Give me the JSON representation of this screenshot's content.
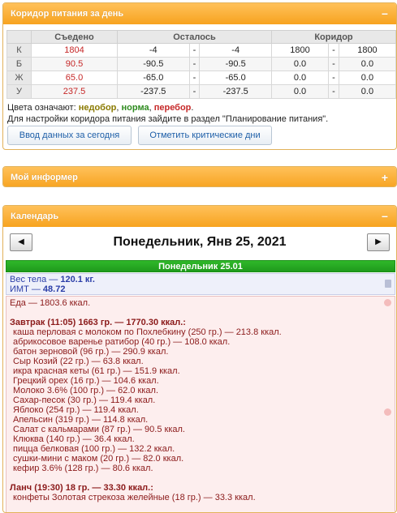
{
  "corridor": {
    "title": "Коридор питания за день",
    "toggle": "−",
    "headers": [
      "",
      "Съедено",
      "Осталось",
      "Коридор"
    ],
    "rows": [
      {
        "label": "К",
        "eaten": "1804",
        "r1": "-4",
        "dash1": "-",
        "r2": "-4",
        "c1": "1800",
        "dash2": "-",
        "c2": "1800"
      },
      {
        "label": "Б",
        "eaten": "90.5",
        "r1": "-90.5",
        "dash1": "-",
        "r2": "-90.5",
        "c1": "0.0",
        "dash2": "-",
        "c2": "0.0"
      },
      {
        "label": "Ж",
        "eaten": "65.0",
        "r1": "-65.0",
        "dash1": "-",
        "r2": "-65.0",
        "c1": "0.0",
        "dash2": "-",
        "c2": "0.0"
      },
      {
        "label": "У",
        "eaten": "237.5",
        "r1": "-237.5",
        "dash1": "-",
        "r2": "-237.5",
        "c1": "0.0",
        "dash2": "-",
        "c2": "0.0"
      }
    ],
    "legend_prefix": "Цвета означают: ",
    "legend_low": "недобор",
    "legend_sep1": ", ",
    "legend_ok": "норма",
    "legend_sep2": ", ",
    "legend_over": "перебор",
    "legend_end": ".",
    "hint": "Для настройки коридора питания зайдите в раздел \"Планирование питания\".",
    "btn_input": "Ввод данных за сегодня",
    "btn_critical": "Отметить критические дни",
    "colors": {
      "low": "#8a7a00",
      "ok": "#2e8b1f",
      "over": "#c62828"
    }
  },
  "informer": {
    "title": "Мой информер",
    "toggle": "+"
  },
  "calendar": {
    "title": "Календарь",
    "toggle": "−",
    "prev": "◀",
    "next": "▶",
    "date_title": "Понедельник, Янв 25, 2021",
    "day_bar": "Понедельник 25.01",
    "weight_line": "Вес тела — ",
    "weight_value": "120.1 кг.",
    "bmi_line": "ИМТ — ",
    "bmi_value": "48.72",
    "food_total": "Еда — 1803.6 ккал.",
    "meals": [
      {
        "title": "Завтрак (11:05) 1663 гр. — 1770.30 ккал.:",
        "items": [
          "каша перловая с молоком по Похлебкину (250 гр.) — 213.8 ккал.",
          "абрикосовое варенье ратибор (40 гр.) — 108.0 ккал.",
          "батон зерновой (96 гр.) — 290.9 ккал.",
          "Сыр Козий (22 гр.) — 63.8 ккал.",
          "икра красная кеты (61 гр.) — 151.9 ккал.",
          "Грецкий орех (16 гр.) — 104.6 ккал.",
          "Молоко 3.6% (100 гр.) — 62.0 ккал.",
          "Сахар-песок (30 гр.) — 119.4 ккал.",
          "Яблоко (254 гр.) — 119.4 ккал.",
          "Апельсин (319 гр.) — 114.8 ккал.",
          "Салат с кальмарами (87 гр.) — 90.5 ккал.",
          "Клюква (140 гр.) — 36.4 ккал.",
          "пицца белковая (100 гр.) — 132.2 ккал.",
          "сушки-мини с маком (20 гр.) — 82.0 ккал.",
          "кефир 3.6% (128 гр.) — 80.6 ккал."
        ]
      },
      {
        "title": "Ланч (19:30) 18 гр. — 33.30 ккал.:",
        "items": [
          "конфеты Золотая стрекоза желейные (18 гр.) — 33.3 ккал."
        ]
      }
    ]
  }
}
